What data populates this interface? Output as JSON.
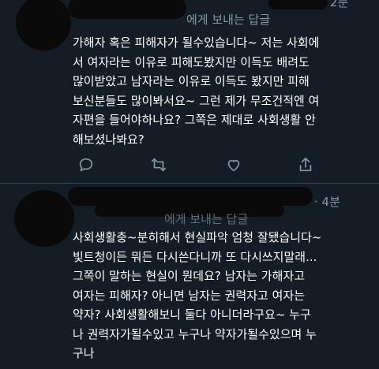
{
  "tweets": [
    {
      "reply_label": "에게 보내는 답글",
      "time": "2분",
      "body": "가해자 혹은 피해자가 될수있습니다~ 저는 사회에\n서 여자라는 이유로 피해도봤지만 이득도 배려도\n많이받았고 남자라는 이유로 이득도 봤지만 피해\n보신분들도 많이봐서요~ 그런 제가 무조건적엔 여\n자편을 들어야하나요? 그쪽은 제대로 사회생활 안\n해보셨나봐요?",
      "actions": [
        "reply-icon",
        "retweet-icon",
        "like-icon",
        "share-icon"
      ]
    },
    {
      "reply_label": "에게 보내는 답글",
      "time": "· 4분",
      "body": "사회생활충~분히해서 현실파악 엄청 잘됐습니다~\n빛트청이든 뭐든 다시쓴다니까 또 다시쓰지말래...\n그쪽이 말하는 현실이 뭔데요? 남자는 가해자고\n여자는 피해자? 아니면 남자는 권력자고 여자는\n약자? 사회생활해보니 둘다 아니더라구요~ 누구\n나 권력자가될수있고 누구나 약자가될수있으며 누\n구나"
    }
  ]
}
